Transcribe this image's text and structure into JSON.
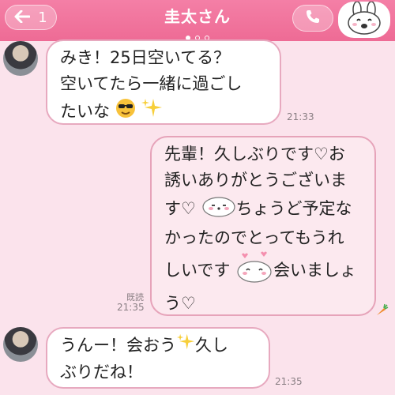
{
  "header": {
    "back_count": "1",
    "title": "圭太さん",
    "page_dots": [
      true,
      false,
      false
    ],
    "accent": "#ee6b95"
  },
  "messages": [
    {
      "sender": "other",
      "line1": "みき！25日空いてる？",
      "line2": "空いてたら一緒に過ごし",
      "line3": "たいな",
      "time": "21:33"
    },
    {
      "sender": "me",
      "line1": "先輩！久しぶりです♡お",
      "line2": "誘いありがとうございま",
      "line3a": "す♡",
      "line3b": "ちょうど予定な",
      "line4": "かったのでとってもうれ",
      "line5a": "しいです",
      "line5b": "会いましょ",
      "line6": "う♡",
      "read": "既読",
      "time": "21:35"
    },
    {
      "sender": "other",
      "line1a": "うんー！会おう",
      "line1b": "久し",
      "line2": "ぶりだね！",
      "time": "21:35"
    }
  ],
  "icons": {
    "back": "arrow-left-icon",
    "call": "phone-icon",
    "sticker": "bunny-sticker-icon",
    "emoji_sunglasses": "sunglasses-emoji",
    "sparkles": "sparkles-emoji",
    "seal_sticker": "seal-sticker",
    "carrot": "carrot-icon"
  }
}
